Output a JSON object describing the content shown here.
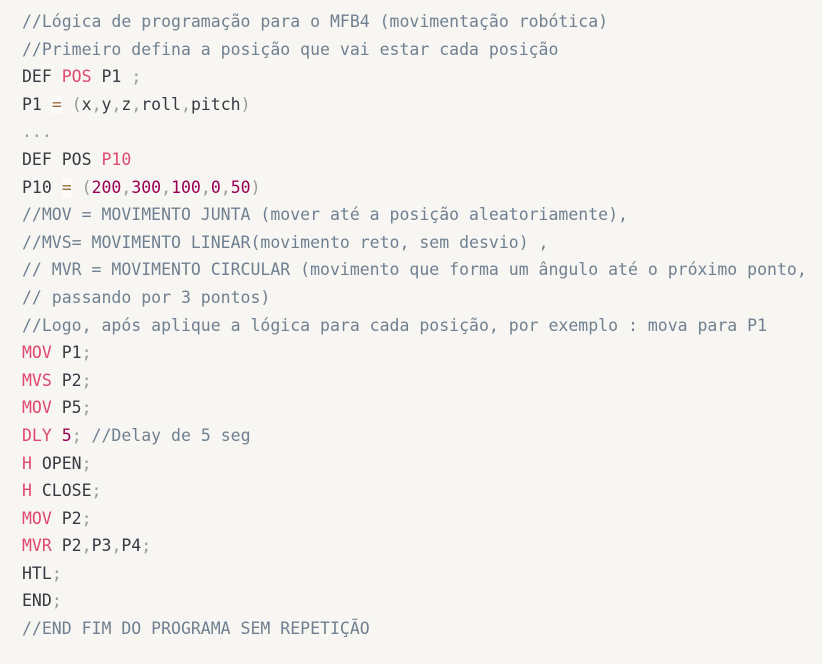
{
  "code_block": {
    "language": "robot-program",
    "lines": [
      [
        [
          "//Lógica de programação para o MFB4 (movimentação robótica)",
          "comment"
        ]
      ],
      [
        [
          "//Primeiro defina a posição que vai estar cada posição",
          "comment"
        ]
      ],
      [
        [
          "DEF ",
          "plain"
        ],
        [
          "POS",
          "keyword"
        ],
        [
          " P1 ",
          "plain"
        ],
        [
          ";",
          "punct"
        ]
      ],
      [
        [
          "P1 ",
          "plain"
        ],
        [
          "=",
          "operator"
        ],
        [
          " ",
          "plain"
        ],
        [
          "(",
          "punct"
        ],
        [
          "x",
          "plain"
        ],
        [
          ",",
          "punct"
        ],
        [
          "y",
          "plain"
        ],
        [
          ",",
          "punct"
        ],
        [
          "z",
          "plain"
        ],
        [
          ",",
          "punct"
        ],
        [
          "roll",
          "plain"
        ],
        [
          ",",
          "punct"
        ],
        [
          "pitch",
          "plain"
        ],
        [
          ")",
          "punct"
        ]
      ],
      [
        [
          "...",
          "punct"
        ]
      ],
      [
        [
          "DEF POS ",
          "plain"
        ],
        [
          "P10",
          "keyword"
        ]
      ],
      [
        [
          "P10 ",
          "plain"
        ],
        [
          "=",
          "operator"
        ],
        [
          " ",
          "plain"
        ],
        [
          "(",
          "punct"
        ],
        [
          "200",
          "number"
        ],
        [
          ",",
          "punct"
        ],
        [
          "300",
          "number"
        ],
        [
          ",",
          "punct"
        ],
        [
          "100",
          "number"
        ],
        [
          ",",
          "punct"
        ],
        [
          "0",
          "number"
        ],
        [
          ",",
          "punct"
        ],
        [
          "50",
          "number"
        ],
        [
          ")",
          "punct"
        ]
      ],
      [
        [
          "//MOV = MOVIMENTO JUNTA (mover até a posição aleatoriamente),",
          "comment"
        ]
      ],
      [
        [
          "//MVS= MOVIMENTO LINEAR(movimento reto, sem desvio) ,",
          "comment"
        ]
      ],
      [
        [
          "// MVR = MOVIMENTO CIRCULAR (movimento que forma um ângulo até o próximo ponto,",
          "comment"
        ]
      ],
      [
        [
          "// passando por 3 pontos)",
          "comment"
        ]
      ],
      [
        [
          "//Logo, após aplique a lógica para cada posição, por exemplo : mova para P1",
          "comment"
        ]
      ],
      [
        [
          "MOV",
          "keyword"
        ],
        [
          " P1",
          "plain"
        ],
        [
          ";",
          "punct"
        ]
      ],
      [
        [
          "MVS",
          "keyword"
        ],
        [
          " P2",
          "plain"
        ],
        [
          ";",
          "punct"
        ]
      ],
      [
        [
          "MOV",
          "keyword"
        ],
        [
          " P5",
          "plain"
        ],
        [
          ";",
          "punct"
        ]
      ],
      [
        [
          "DLY",
          "keyword"
        ],
        [
          " ",
          "plain"
        ],
        [
          "5",
          "number"
        ],
        [
          ";",
          "punct"
        ],
        [
          " //Delay de 5 seg",
          "comment"
        ]
      ],
      [
        [
          "H",
          "keyword"
        ],
        [
          " OPEN",
          "plain"
        ],
        [
          ";",
          "punct"
        ]
      ],
      [
        [
          "H",
          "keyword"
        ],
        [
          " CLOSE",
          "plain"
        ],
        [
          ";",
          "punct"
        ]
      ],
      [
        [
          "MOV",
          "keyword"
        ],
        [
          " P2",
          "plain"
        ],
        [
          ";",
          "punct"
        ]
      ],
      [
        [
          "MVR",
          "keyword"
        ],
        [
          " P2",
          "plain"
        ],
        [
          ",",
          "punct"
        ],
        [
          "P3",
          "plain"
        ],
        [
          ",",
          "punct"
        ],
        [
          "P4",
          "plain"
        ],
        [
          ";",
          "punct"
        ]
      ],
      [
        [
          "HTL",
          "plain"
        ],
        [
          ";",
          "punct"
        ]
      ],
      [
        [
          "END",
          "plain"
        ],
        [
          ";",
          "punct"
        ]
      ],
      [
        [
          "//END FIM DO PROGRAMA SEM REPETIÇÃO",
          "comment"
        ]
      ]
    ]
  },
  "colors": {
    "background": "#f7f6f3",
    "comment": "#708090",
    "keyword": "#e0486e",
    "number": "#990055",
    "punctuation": "#999999",
    "operator": "#9a6e3a",
    "text": "#383a42"
  }
}
